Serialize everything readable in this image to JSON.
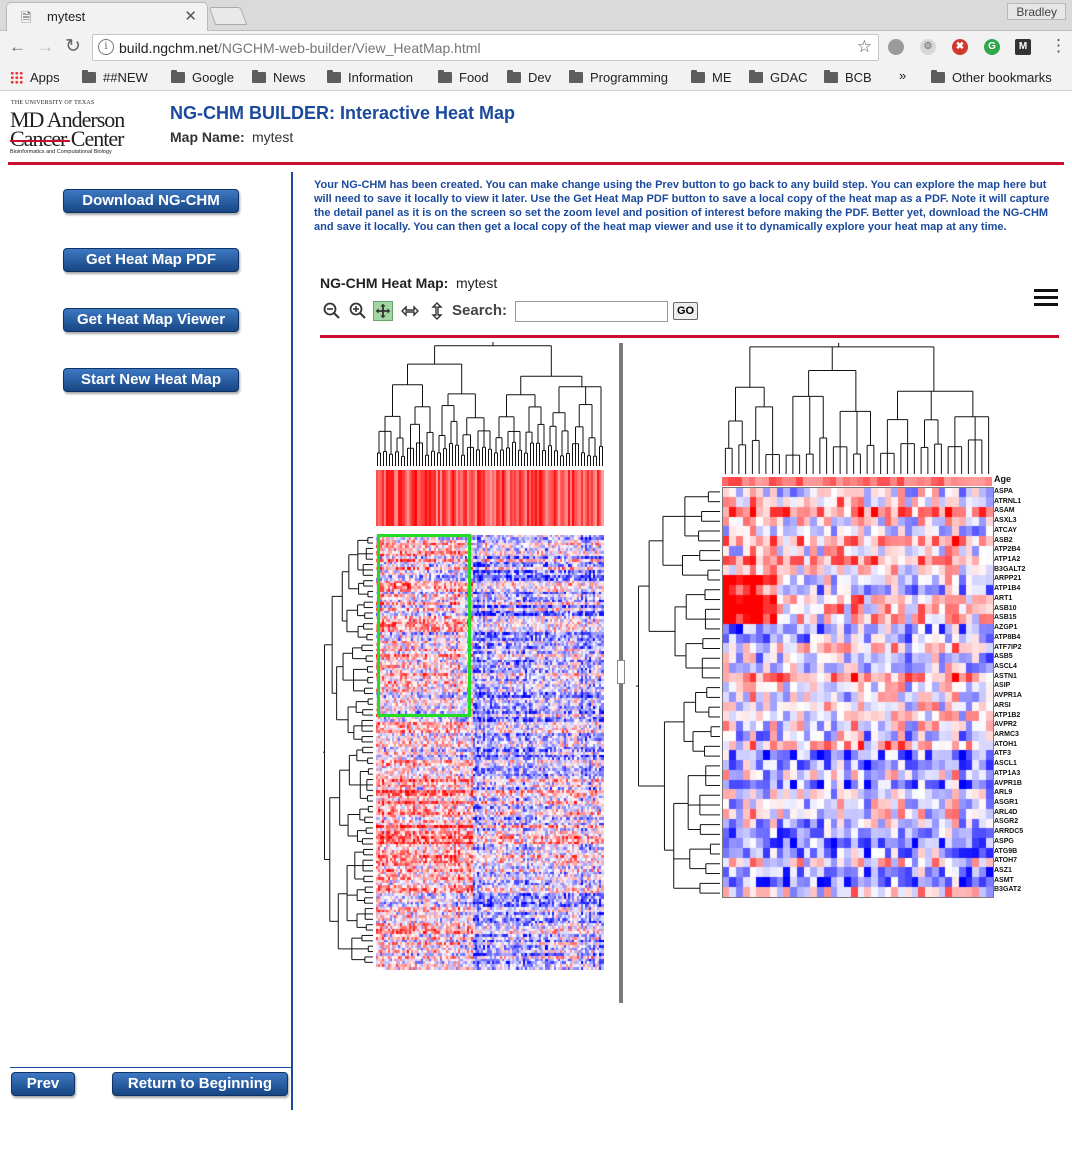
{
  "browser": {
    "tab_title": "mytest",
    "profile_name": "Bradley",
    "url_domain": "build.ngchm.net",
    "url_path": "/NGCHM-web-builder/View_HeatMap.html",
    "bookmarks": [
      "Apps",
      "##NEW",
      "Google",
      "News",
      "Information",
      "Food",
      "Dev",
      "Programming",
      "ME",
      "GDAC",
      "BCB"
    ],
    "overflow": "»",
    "other_bookmarks": "Other bookmarks"
  },
  "header": {
    "logo_line1": "THE UNIVERSITY OF TEXAS",
    "logo_line2": "MD Anderson",
    "logo_line3": "Cancer Center",
    "logo_line4": "Bioinformatics and Computational Biology",
    "title": "NG-CHM BUILDER: Interactive Heat Map",
    "map_name_label": "Map Name:",
    "map_name": "mytest"
  },
  "sidebar": {
    "download": "Download NG-CHM",
    "pdf": "Get Heat Map PDF",
    "viewer": "Get Heat Map Viewer",
    "new_map": "Start New Heat Map",
    "prev": "Prev",
    "return": "Return to Beginning"
  },
  "notice": "Your NG-CHM has been created. You can make change using the Prev button to go back to any build step. You can explore the map here but will need to save it locally to view it later. Use the Get Heat Map PDF button to save a local copy of the heat map as a PDF. Note it will capture the detail panel as it is on the screen so set the zoom level and position of interest before making the PDF. Better yet, download the NG-CHM and save it locally. You can then get a local copy of the heat map viewer and use it to dynamically explore your heat map at any time.",
  "viewer": {
    "title_label": "NG-CHM Heat Map:",
    "title_value": "mytest",
    "search_label": "Search:",
    "search_value": "",
    "go_label": "GO",
    "covariate_label": "Age",
    "row_labels": [
      "ASPA",
      "ATRNL1",
      "ASAM",
      "ASXL3",
      "ATCAY",
      "ASB2",
      "ATP2B4",
      "ATP1A2",
      "B3GALT2",
      "ARPP21",
      "ATP1B4",
      "ART1",
      "ASB10",
      "ASB15",
      "AZGP1",
      "ATP8B4",
      "ATF7IP2",
      "ASB5",
      "ASCL4",
      "ASTN1",
      "ASIP",
      "AVPR1A",
      "ARSI",
      "ATP1B2",
      "AVPR2",
      "ARMC3",
      "ATOH1",
      "ATF3",
      "ASCL1",
      "ATP1A3",
      "AVPR1B",
      "ARL9",
      "ASGR1",
      "ARL4D",
      "ASGR2",
      "ARRDC5",
      "ASPG",
      "ATG9B",
      "ATOH7",
      "ASZ1",
      "ASMT",
      "B3GAT2"
    ]
  },
  "colors": {
    "accent_blue": "#1b4a9c",
    "rule_red": "#c8102e",
    "heat_high": "#ff0000",
    "heat_low": "#0000ff",
    "selection": "#22dd22"
  },
  "icons": [
    "zoom-out-icon",
    "zoom-in-icon",
    "pan-icon",
    "horizontal-icon",
    "vertical-icon",
    "menu-icon"
  ]
}
